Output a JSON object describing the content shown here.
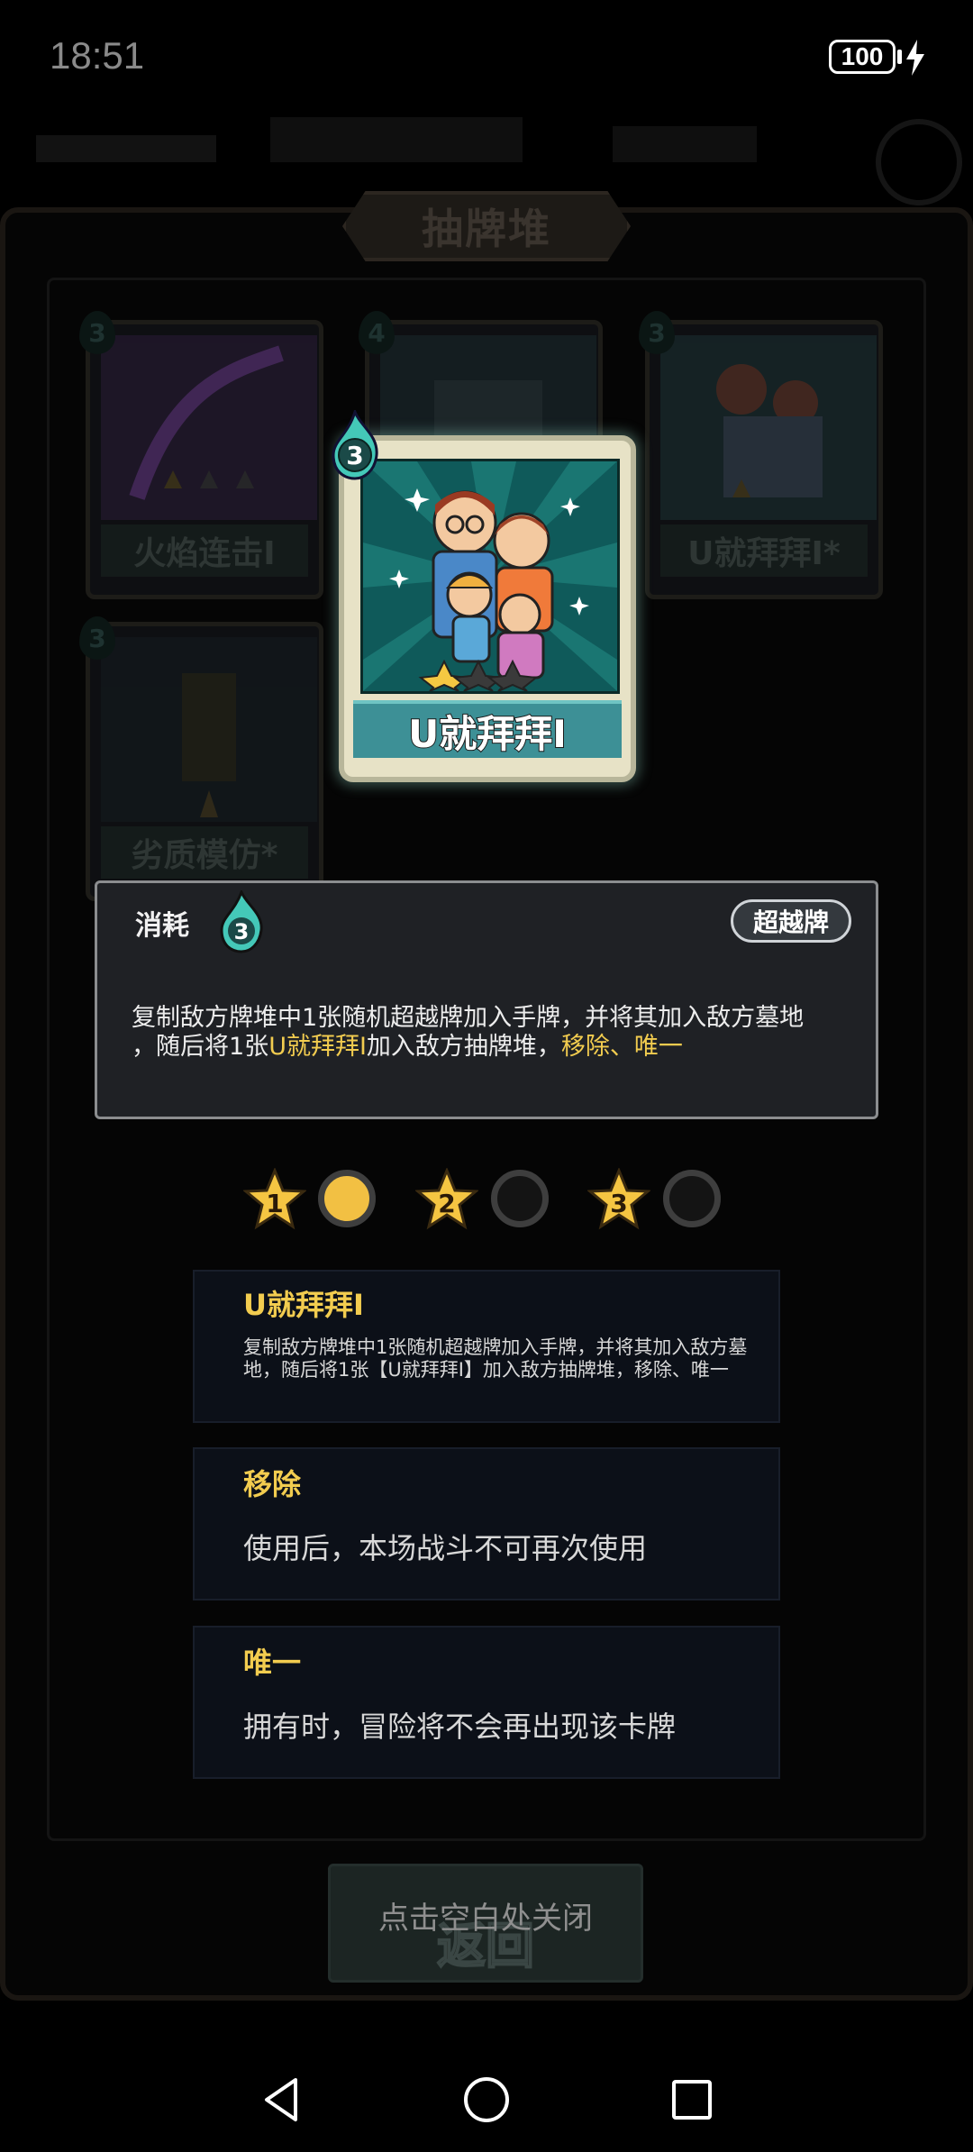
{
  "status_bar": {
    "time": "18:51",
    "battery": "100"
  },
  "pile": {
    "title": "抽牌堆"
  },
  "background_cards": [
    {
      "name": "火焰连击I",
      "cost": "3"
    },
    {
      "name": "",
      "cost": "4"
    },
    {
      "name": "U就拜拜I*",
      "cost": "3"
    },
    {
      "name": "劣质模仿*",
      "cost": "3"
    }
  ],
  "card": {
    "name": "U就拜拜I",
    "cost": "3",
    "cost_label": "消耗",
    "type": "超越牌",
    "description_parts": [
      {
        "text": "复制敌方牌堆中1张随机超越牌加入手牌，并将其加入敌方墓地"
      },
      {
        "text": "，随后将1张"
      },
      {
        "text": "U就拜拜I"
      },
      {
        "text": "加入敌方抽牌堆，"
      },
      {
        "text": "移除"
      },
      {
        "text": "、"
      },
      {
        "text": "唯一"
      }
    ]
  },
  "levels": [
    {
      "star": "1",
      "state": "active"
    },
    {
      "star": "2",
      "state": "empty"
    },
    {
      "star": "3",
      "state": "empty"
    }
  ],
  "keywords": [
    {
      "title": "U就拜拜I",
      "body": "复制敌方牌堆中1张随机超越牌加入手牌，并将其加入敌方墓地，随后将1张【U就拜拜I】加入敌方抽牌堆，移除、唯一"
    },
    {
      "title": "移除",
      "body": "使用后，本场战斗不可再次使用"
    },
    {
      "title": "唯一",
      "body": "拥有时，冒险将不会再出现该卡牌"
    }
  ],
  "footer": {
    "hint": "点击空白处关闭",
    "button_label": "返回"
  },
  "colors": {
    "highlight": "#f2cc4f",
    "panel": "#1f2125",
    "card_plate": "#3d9096"
  }
}
